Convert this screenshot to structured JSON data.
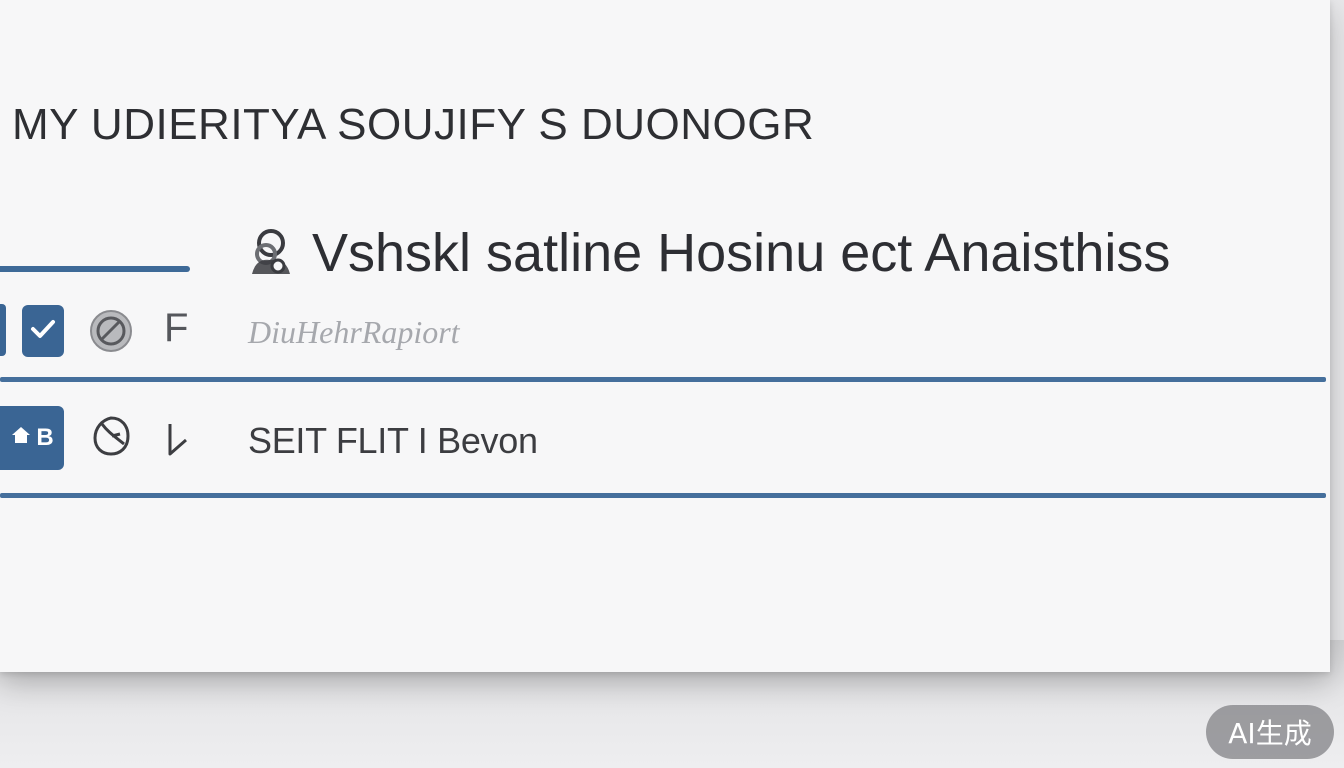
{
  "app": {
    "title": "MY UDIERITYA SOUJIFY S DUONOGR"
  },
  "header": {
    "section_title": "Vshskl satline Hosinu  ect Anaisthiss",
    "icon": "user-group-icon"
  },
  "rows": [
    {
      "checkbox_icon": "checkmark-icon",
      "status_icon": "disabled-circle-icon",
      "letter": "F",
      "label": "DiuHehrRapiort"
    },
    {
      "button_icon": "home-icon",
      "button_text": "B",
      "shape_icon": "globe-icon",
      "arrow_icon": "arrow-icon",
      "label": "SEIT FLIT I Bevon"
    }
  ],
  "watermark": {
    "text": "AI生成"
  },
  "colors": {
    "accent": "#3a6594",
    "divider": "#456f9c",
    "panel": "#f7f7f8",
    "text": "#2e2f33"
  }
}
